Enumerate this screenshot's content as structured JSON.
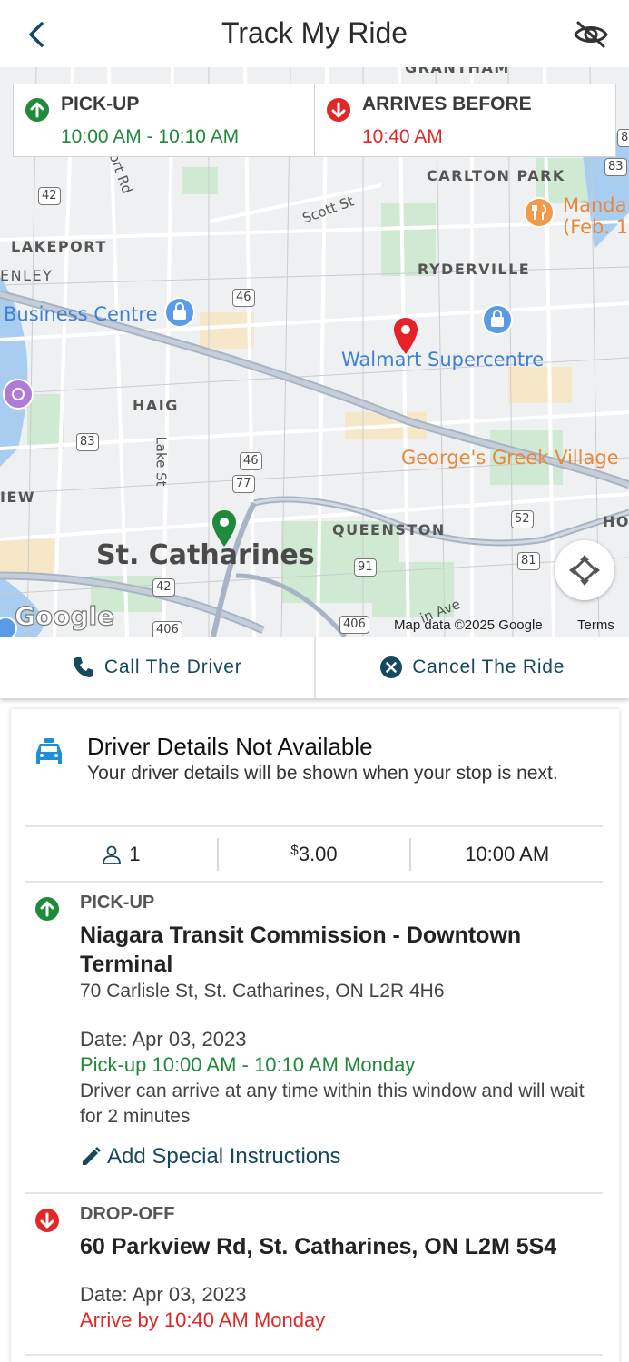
{
  "header": {
    "title": "Track My Ride"
  },
  "map": {
    "labels": {
      "grantham": "GRANTHAM",
      "carlton_park": "CARLTON PARK",
      "lakeport": "LAKEPORT",
      "enley": "ENLEY",
      "ryderville": "RYDERVILLE",
      "haig": "HAIG",
      "iew": "IEW",
      "queenston": "QUEENSTON",
      "ho": "HO",
      "city": "St. Catharines",
      "business_centre": "Business Centre",
      "walmart": "Walmart Supercentre",
      "georges": "George's Greek Village",
      "manda_1": "Manda",
      "manda_2": "(Feb. 1",
      "scott_st": "Scott St",
      "ort_rd": "ort Rd",
      "lake_st": "Lake St",
      "in_ave": "in Ave"
    },
    "shields": [
      "42",
      "46",
      "83",
      "46",
      "77",
      "52",
      "81",
      "91",
      "42",
      "406",
      "406",
      "83",
      "8"
    ],
    "google_logo": "Google",
    "attribution": "Map data ©2025 Google",
    "terms": "Terms"
  },
  "times": {
    "pickup_label": "PICK-UP",
    "pickup_value": "10:00 AM - 10:10 AM",
    "arrive_label": "ARRIVES BEFORE",
    "arrive_value": "10:40 AM"
  },
  "actions": {
    "call": "Call The Driver",
    "cancel": "Cancel The Ride"
  },
  "driver": {
    "title": "Driver Details Not Available",
    "subtitle": "Your driver details will be shown when your stop is next."
  },
  "stats": {
    "passengers": "1",
    "currency": "$",
    "fare": "3.00",
    "time": "10:00 AM"
  },
  "pickup": {
    "kind": "PICK-UP",
    "name": "Niagara Transit Commission - Downtown Terminal",
    "address": "70 Carlisle St, St. Catharines, ON L2R 4H6",
    "date": "Date: Apr 03, 2023",
    "window": "Pick-up 10:00 AM - 10:10 AM Monday",
    "note": "Driver can arrive at any time within this window and will wait for 2 minutes",
    "special": "Add Special Instructions"
  },
  "dropoff": {
    "kind": "DROP-OFF",
    "name": "60 Parkview Rd, St. Catharines, ON L2M 5S4",
    "date": "Date: Apr 03, 2023",
    "window": "Arrive by 10:40 AM Monday"
  },
  "colors": {
    "green": "#1f8a3a",
    "red": "#e12727",
    "accent": "#16485e"
  }
}
